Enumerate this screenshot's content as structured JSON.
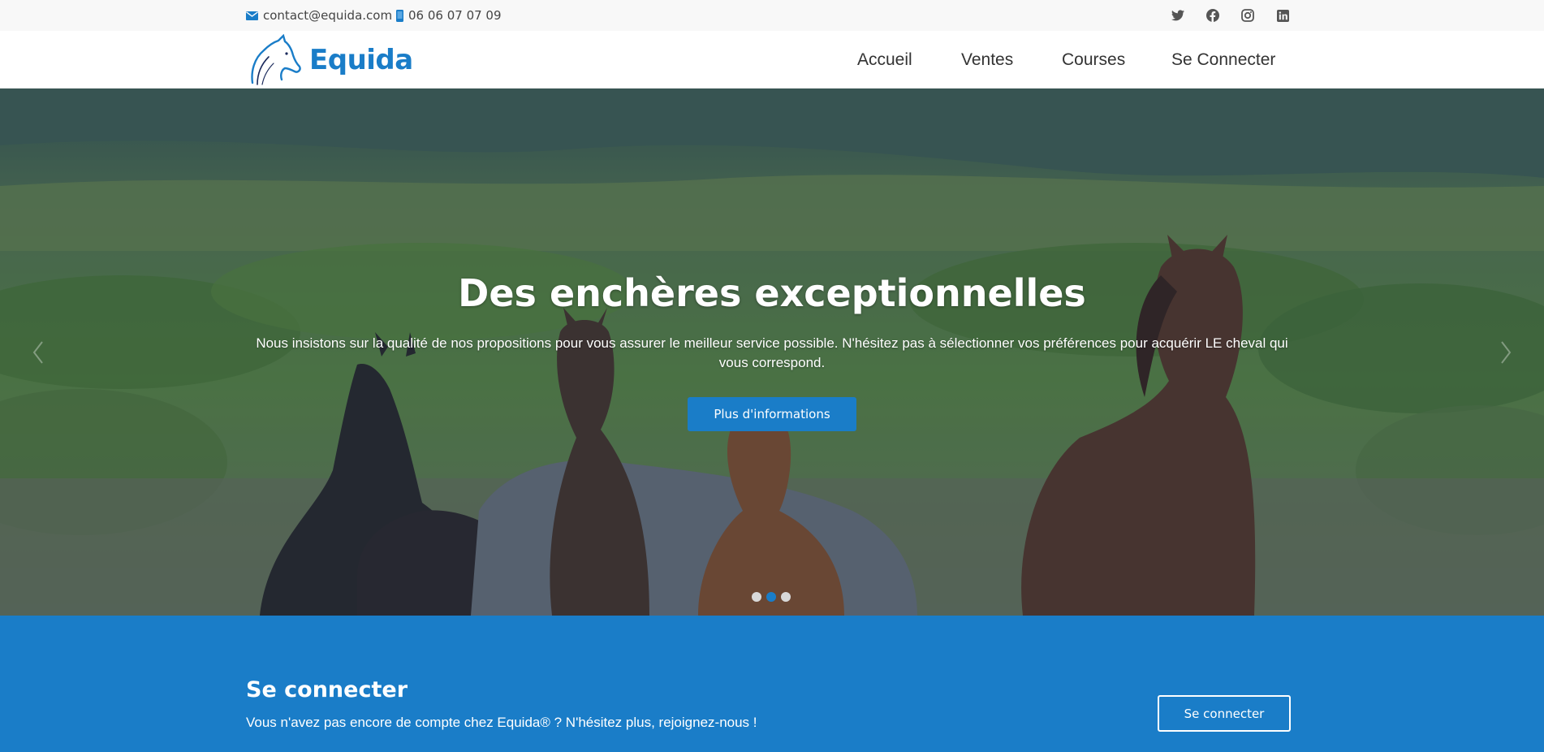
{
  "topbar": {
    "email": "contact@equida.com",
    "phone": "06 06 07 07 09",
    "email_icon": "envelope-icon",
    "phone_icon": "mobile-phone-icon",
    "social_icons": [
      "twitter-icon",
      "facebook-icon",
      "instagram-icon",
      "linkedin-icon"
    ]
  },
  "header": {
    "logo_text": "Equida",
    "nav": [
      "Accueil",
      "Ventes",
      "Courses",
      "Se Connecter"
    ]
  },
  "hero": {
    "title": "Des enchères exceptionnelles",
    "text": "Nous insistons sur la qualité de nos propositions pour vous assurer le meilleur service possible. N'hésitez pas à sélectionner vos préférences pour acquérir LE cheval qui vous correspond.",
    "button_label": "Plus d'informations",
    "slides_count": 3,
    "active_slide": 2
  },
  "band": {
    "title": "Se connecter",
    "text": "Vous n'avez pas encore de compte chez Equida® ? N'hésitez plus, rejoignez-nous !",
    "button_label": "Se connecter"
  },
  "colors": {
    "brand_blue": "#1a7dc8",
    "topbar_bg": "#f8f8f8",
    "text_dark": "#333333"
  }
}
